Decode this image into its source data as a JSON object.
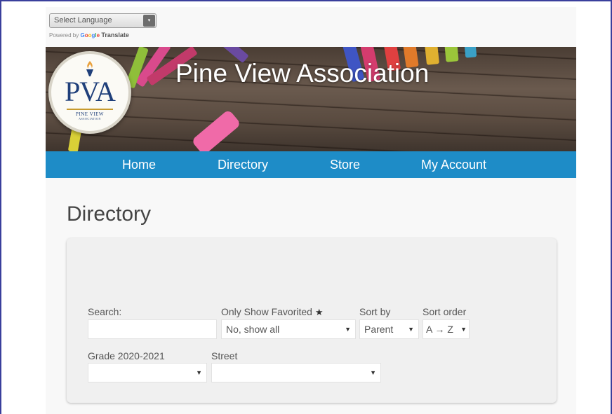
{
  "translate": {
    "select_label": "Select Language",
    "arrow": "▾",
    "powered_by": "Powered by",
    "google": [
      "G",
      "o",
      "o",
      "g",
      "l",
      "e"
    ],
    "translate": "Translate"
  },
  "header": {
    "site_title": "Pine View Association",
    "logo_text": "PVA",
    "logo_subtext": "PINE VIEW",
    "logo_tagline": "ASSOCIATION"
  },
  "nav": {
    "items": [
      {
        "label": "Home"
      },
      {
        "label": "Directory"
      },
      {
        "label": "Store"
      },
      {
        "label": "My Account"
      }
    ]
  },
  "main": {
    "title": "Directory"
  },
  "filters": {
    "search_label": "Search:",
    "search_value": "",
    "favorited_label": "Only Show Favorited",
    "favorited_icon": "star-icon",
    "favorited_value": "No, show all",
    "sort_by_label": "Sort by",
    "sort_by_value": "Parent",
    "sort_order_label": "Sort order",
    "sort_order_value": "A → Z",
    "grade_label": "Grade 2020-2021",
    "grade_value": "",
    "street_label": "Street",
    "street_value": ""
  },
  "colors": {
    "nav_bg": "#1e8cc7",
    "frame_border": "#3a3f9c",
    "logo_blue": "#1f3f7a"
  }
}
